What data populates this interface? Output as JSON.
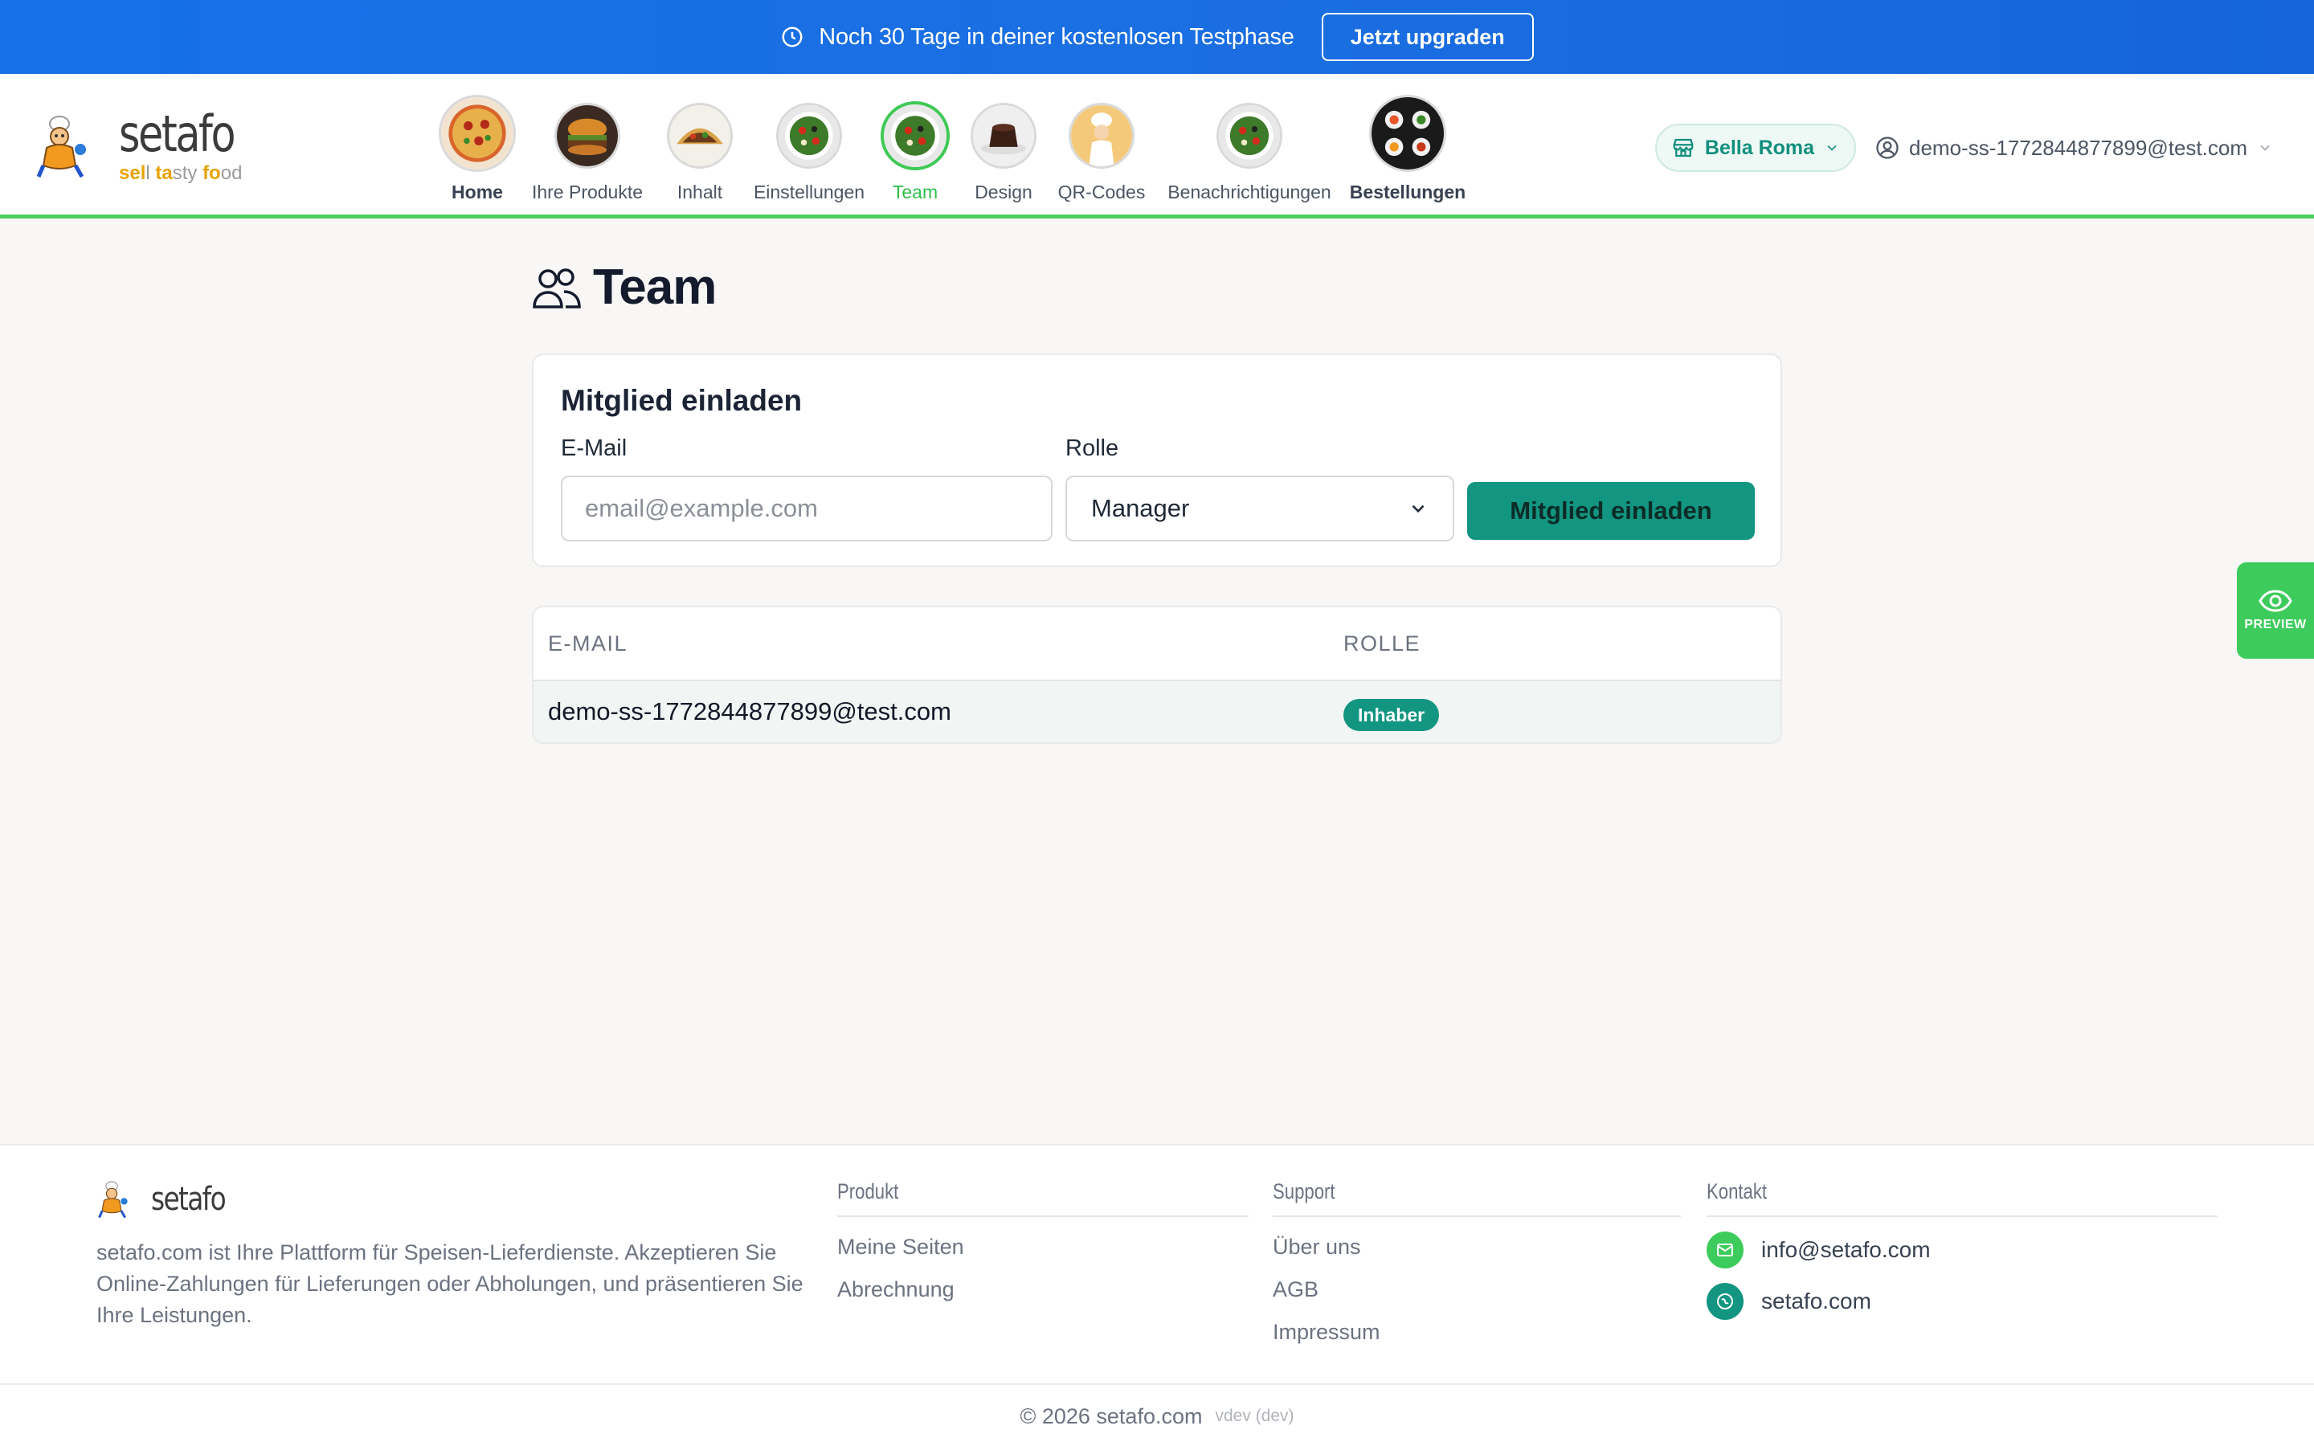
{
  "promo": {
    "text": "Noch 30 Tage in deiner kostenlosen Testphase",
    "upgrade_label": "Jetzt upgraden"
  },
  "brand": {
    "name": "setafo",
    "tagline_parts": [
      "sel",
      "l ",
      "ta",
      "sty ",
      "fo",
      "od"
    ]
  },
  "nav": {
    "items": [
      {
        "label": "Home",
        "icon": "pizza-icon"
      },
      {
        "label": "Ihre Produkte",
        "icon": "burger-icon"
      },
      {
        "label": "Inhalt",
        "icon": "tacos-icon"
      },
      {
        "label": "Einstellungen",
        "icon": "salad-icon"
      },
      {
        "label": "Team",
        "icon": "salad-icon"
      },
      {
        "label": "Design",
        "icon": "cake-icon"
      },
      {
        "label": "QR-Codes",
        "icon": "chef-icon"
      },
      {
        "label": "Benachrichtigungen",
        "icon": "salad-icon"
      },
      {
        "label": "Bestellungen",
        "icon": "sushi-icon"
      }
    ],
    "active": "Team"
  },
  "store_switcher": {
    "label": "Bella Roma"
  },
  "user_menu": {
    "email": "demo-ss-1772844877899@test.com"
  },
  "page": {
    "title": "Team"
  },
  "invite": {
    "title": "Mitglied einladen",
    "email_label": "E-Mail",
    "email_placeholder": "email@example.com",
    "role_label": "Rolle",
    "role_value": "Manager",
    "button_label": "Mitglied einladen"
  },
  "members": {
    "columns": [
      "E-MAIL",
      "ROLLE"
    ],
    "rows": [
      {
        "email": "demo-ss-1772844877899@test.com",
        "role": "Inhaber"
      }
    ]
  },
  "preview": {
    "label": "PREVIEW"
  },
  "footer": {
    "brand": "setafo",
    "description": "setafo.com ist Ihre Plattform für Speisen-Lieferdienste. Akzeptieren Sie Online-Zahlungen für Lieferungen oder Abholungen, und präsentieren Sie Ihre Leistungen.",
    "produkt": {
      "title": "Produkt",
      "links": [
        "Meine Seiten",
        "Abrechnung"
      ]
    },
    "support": {
      "title": "Support",
      "links": [
        "Über uns",
        "AGB",
        "Impressum"
      ]
    },
    "kontakt": {
      "title": "Kontakt",
      "email": "info@setafo.com",
      "website": "setafo.com"
    },
    "copyright": "© 2026 setafo.com",
    "version": "vdev (dev)"
  },
  "colors": {
    "banner": "#1670e6",
    "accent_green": "#3ec955",
    "teal": "#129581"
  }
}
